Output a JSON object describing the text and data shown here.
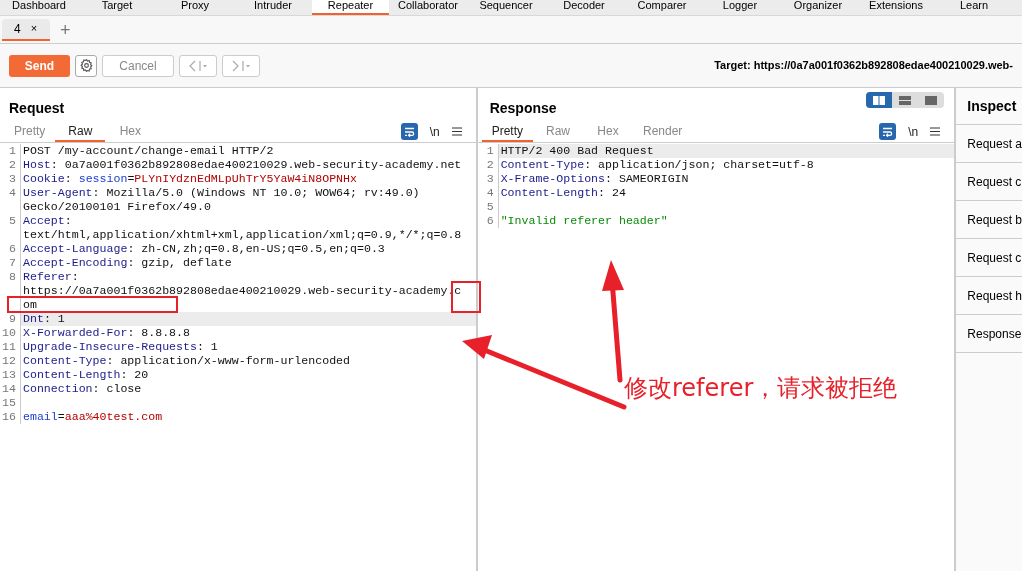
{
  "main_tabs": [
    {
      "label": "Dashboard",
      "selected": false
    },
    {
      "label": "Target",
      "selected": false
    },
    {
      "label": "Proxy",
      "selected": false
    },
    {
      "label": "Intruder",
      "selected": false
    },
    {
      "label": "Repeater",
      "selected": true
    },
    {
      "label": "Collaborator",
      "selected": false
    },
    {
      "label": "Sequencer",
      "selected": false
    },
    {
      "label": "Decoder",
      "selected": false
    },
    {
      "label": "Comparer",
      "selected": false
    },
    {
      "label": "Logger",
      "selected": false
    },
    {
      "label": "Organizer",
      "selected": false
    },
    {
      "label": "Extensions",
      "selected": false
    },
    {
      "label": "Learn",
      "selected": false
    }
  ],
  "repeater_tabs": [
    {
      "label": "4",
      "close": "×",
      "selected": true
    }
  ],
  "new_tab": "+",
  "toolbar": {
    "send": "Send",
    "cancel": "Cancel",
    "target": "Target: https://0a7a001f0362b892808edae400210029.web-"
  },
  "request": {
    "title": "Request",
    "tabs": [
      {
        "label": "Pretty",
        "selected": false
      },
      {
        "label": "Raw",
        "selected": true
      },
      {
        "label": "Hex",
        "selected": false
      }
    ],
    "wrap_on": true,
    "newline_label": "\\n",
    "lines": [
      {
        "num": "1",
        "current": false,
        "rows": [
          [
            {
              "kind": "plain",
              "text": "POST /my-account/change-email HTTP/2"
            }
          ]
        ]
      },
      {
        "num": "2",
        "current": false,
        "rows": [
          [
            {
              "kind": "name",
              "text": "Host"
            },
            {
              "kind": "plain",
              "text": ": 0a7a001f0362b892808edae400210029.web-security-academy.net"
            }
          ]
        ]
      },
      {
        "num": "3",
        "current": false,
        "rows": [
          [
            {
              "kind": "name",
              "text": "Cookie"
            },
            {
              "kind": "plain",
              "text": ": "
            },
            {
              "kind": "param",
              "text": "session"
            },
            {
              "kind": "plain",
              "text": "="
            },
            {
              "kind": "pval",
              "text": "PLYnIYdznEdMLpUhTrY5YaW4iN8OPNHx"
            }
          ]
        ]
      },
      {
        "num": "4",
        "current": false,
        "rows": [
          [
            {
              "kind": "name",
              "text": "User-Agent"
            },
            {
              "kind": "plain",
              "text": ": Mozilla/5.0 (Windows NT 10.0; WOW64; rv:49.0)"
            }
          ],
          [
            {
              "kind": "plain",
              "text": "Gecko/20100101 Firefox/49.0"
            }
          ]
        ]
      },
      {
        "num": "5",
        "current": false,
        "rows": [
          [
            {
              "kind": "name",
              "text": "Accept"
            },
            {
              "kind": "plain",
              "text": ":"
            }
          ],
          [
            {
              "kind": "plain",
              "text": "text/html,application/xhtml+xml,application/xml;q=0.9,*/*;q=0.8"
            }
          ]
        ]
      },
      {
        "num": "6",
        "current": false,
        "rows": [
          [
            {
              "kind": "name",
              "text": "Accept-Language"
            },
            {
              "kind": "plain",
              "text": ": zh-CN,zh;q=0.8,en-US;q=0.5,en;q=0.3"
            }
          ]
        ]
      },
      {
        "num": "7",
        "current": false,
        "rows": [
          [
            {
              "kind": "name",
              "text": "Accept-Encoding"
            },
            {
              "kind": "plain",
              "text": ": gzip, deflate"
            }
          ]
        ]
      },
      {
        "num": "8",
        "current": false,
        "rows": [
          [
            {
              "kind": "name",
              "text": "Referer"
            },
            {
              "kind": "plain",
              "text": ":"
            }
          ],
          [
            {
              "kind": "plain",
              "text": "https://0a7a001f0362b892808edae400210029.web-security-academy.c"
            }
          ],
          [
            {
              "kind": "plain",
              "text": "om"
            }
          ]
        ]
      },
      {
        "num": "9",
        "current": true,
        "rows": [
          [
            {
              "kind": "name",
              "text": "Dnt"
            },
            {
              "kind": "plain",
              "text": ": 1"
            }
          ]
        ]
      },
      {
        "num": "10",
        "current": false,
        "rows": [
          [
            {
              "kind": "name",
              "text": "X-Forwarded-For"
            },
            {
              "kind": "plain",
              "text": ": 8.8.8.8"
            }
          ]
        ]
      },
      {
        "num": "11",
        "current": false,
        "rows": [
          [
            {
              "kind": "name",
              "text": "Upgrade-Insecure-Requests"
            },
            {
              "kind": "plain",
              "text": ": 1"
            }
          ]
        ]
      },
      {
        "num": "12",
        "current": false,
        "rows": [
          [
            {
              "kind": "name",
              "text": "Content-Type"
            },
            {
              "kind": "plain",
              "text": ": application/x-www-form-urlencoded"
            }
          ]
        ]
      },
      {
        "num": "13",
        "current": false,
        "rows": [
          [
            {
              "kind": "name",
              "text": "Content-Length"
            },
            {
              "kind": "plain",
              "text": ": 20"
            }
          ]
        ]
      },
      {
        "num": "14",
        "current": false,
        "rows": [
          [
            {
              "kind": "name",
              "text": "Connection"
            },
            {
              "kind": "plain",
              "text": ": close"
            }
          ]
        ]
      },
      {
        "num": "15",
        "current": false,
        "rows": [
          []
        ]
      },
      {
        "num": "16",
        "current": false,
        "rows": [
          [
            {
              "kind": "param",
              "text": "email"
            },
            {
              "kind": "plain",
              "text": "="
            },
            {
              "kind": "pval",
              "text": "aaa%40test.com"
            }
          ]
        ]
      }
    ]
  },
  "response": {
    "title": "Response",
    "view_modes": [
      {
        "selected": true
      },
      {
        "selected": false
      },
      {
        "selected": false
      }
    ],
    "tabs": [
      {
        "label": "Pretty",
        "selected": true
      },
      {
        "label": "Raw",
        "selected": false
      },
      {
        "label": "Hex",
        "selected": false
      },
      {
        "label": "Render",
        "selected": false
      }
    ],
    "wrap_on": true,
    "newline_label": "\\n",
    "lines": [
      {
        "num": "1",
        "current": true,
        "rows": [
          [
            {
              "kind": "plain",
              "text": "HTTP/2 400 Bad Request"
            }
          ]
        ]
      },
      {
        "num": "2",
        "current": false,
        "rows": [
          [
            {
              "kind": "name",
              "text": "Content-Type"
            },
            {
              "kind": "plain",
              "text": ": application/json; charset=utf-8"
            }
          ]
        ]
      },
      {
        "num": "3",
        "current": false,
        "rows": [
          [
            {
              "kind": "name",
              "text": "X-Frame-Options"
            },
            {
              "kind": "plain",
              "text": ": SAMEORIGIN"
            }
          ]
        ]
      },
      {
        "num": "4",
        "current": false,
        "rows": [
          [
            {
              "kind": "name",
              "text": "Content-Length"
            },
            {
              "kind": "plain",
              "text": ": 24"
            }
          ]
        ]
      },
      {
        "num": "5",
        "current": false,
        "rows": [
          []
        ]
      },
      {
        "num": "6",
        "current": false,
        "rows": [
          [
            {
              "kind": "string",
              "text": "\"Invalid referer header\""
            }
          ]
        ]
      }
    ]
  },
  "inspector": {
    "title": "Inspect",
    "items": [
      "Request a",
      "Request c",
      "Request b",
      "Request c",
      "Request h",
      "Response"
    ]
  },
  "annotation": {
    "text": "修改referer，请求被拒绝"
  }
}
